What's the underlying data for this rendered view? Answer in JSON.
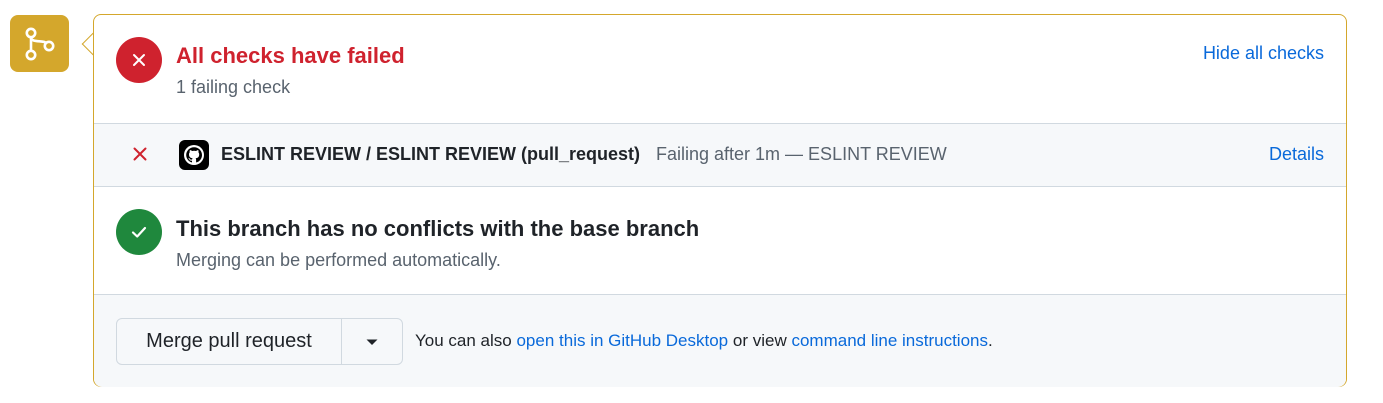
{
  "state_icon": {
    "icon": "git-branch-icon",
    "color": "#d4a72c"
  },
  "status": {
    "title": "All checks have failed",
    "subtitle": "1 failing check",
    "toggle_link": "Hide all checks",
    "icon": "x-circle-icon",
    "color": "#cf222e"
  },
  "checks": [
    {
      "name": "ESLINT REVIEW / ESLINT REVIEW (pull_request)",
      "description": "Failing after 1m — ESLINT REVIEW",
      "details_link": "Details",
      "icon": "x-icon",
      "avatar_icon": "github-mark-icon"
    }
  ],
  "conflicts": {
    "title": "This branch has no conflicts with the base branch",
    "subtitle": "Merging can be performed automatically.",
    "icon": "check-circle-icon",
    "color": "#1f883d"
  },
  "merge": {
    "button_label": "Merge pull request",
    "dropdown_icon": "triangle-down-icon",
    "note_prefix": "You can also",
    "desktop_link": "open this in GitHub Desktop",
    "note_middle": "or view",
    "cli_link": "command line instructions",
    "note_suffix": "."
  }
}
